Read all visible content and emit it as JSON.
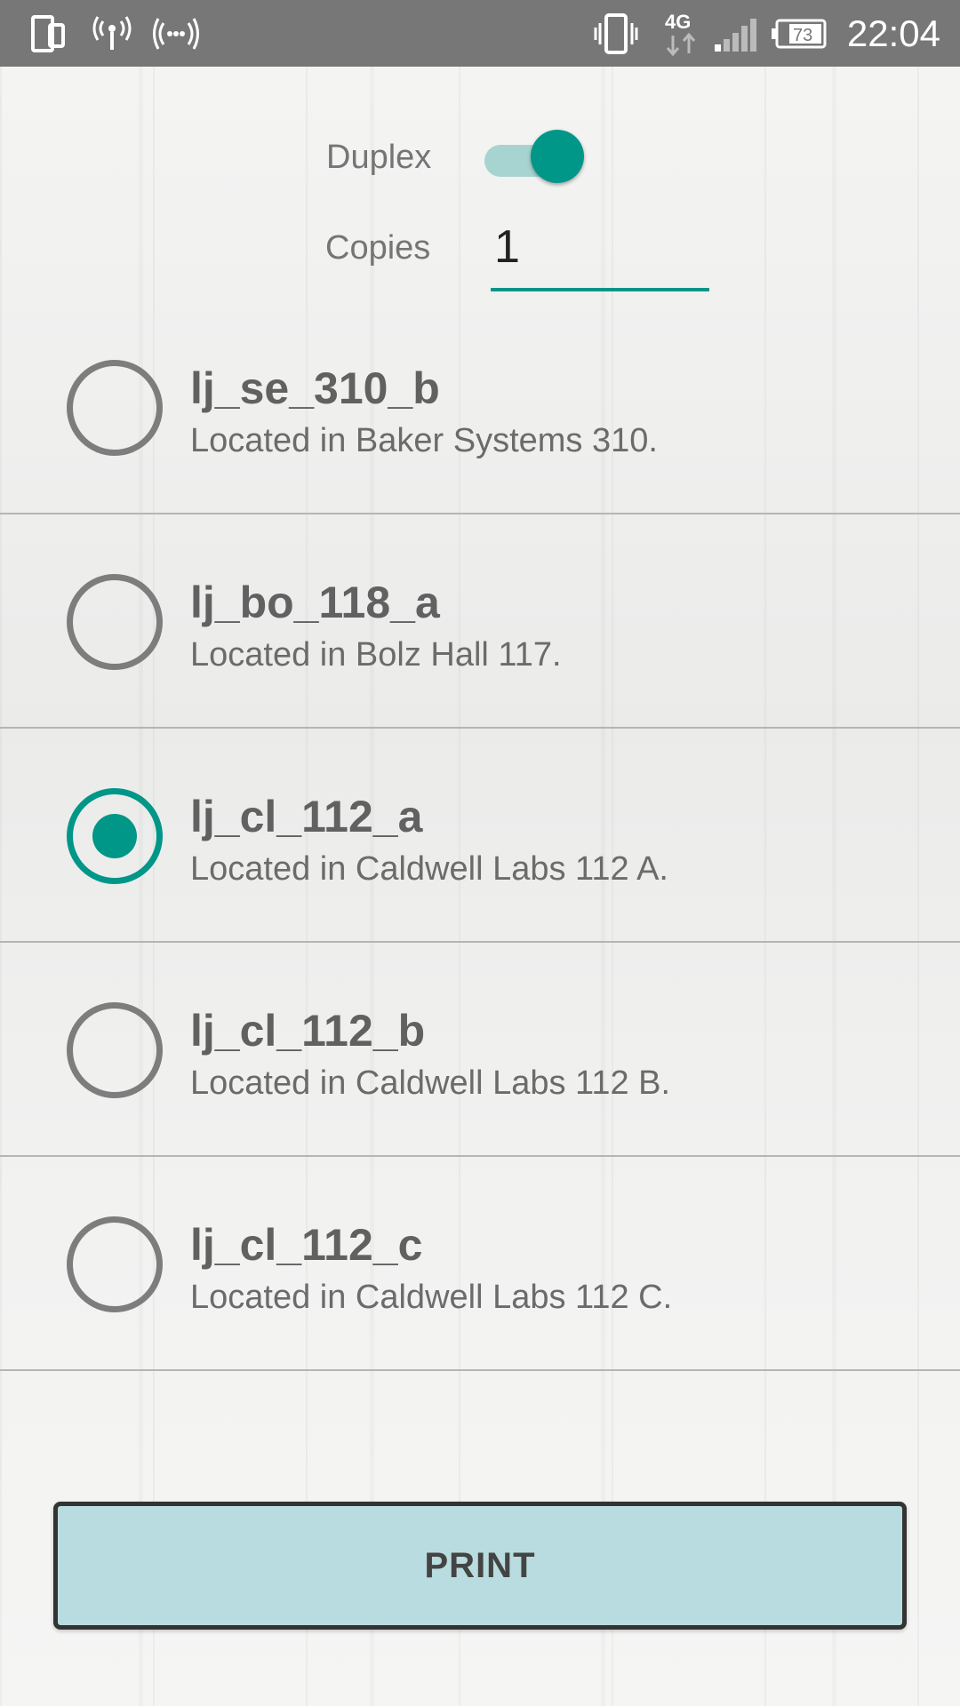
{
  "status_bar": {
    "time": "22:04",
    "battery_level": "73",
    "network_type": "4G",
    "icons": [
      "screen-mirror-icon",
      "hotspot-icon",
      "nfc-icon",
      "vibrate-icon",
      "4g-data-icon",
      "signal-icon",
      "battery-icon"
    ]
  },
  "options": {
    "duplex_label": "Duplex",
    "duplex_on": true,
    "copies_label": "Copies",
    "copies_value": "1"
  },
  "printers": [
    {
      "name": "lj_se_310_b",
      "location": "Located in Baker Systems 310.",
      "selected": false
    },
    {
      "name": "lj_bo_118_a",
      "location": "Located in Bolz Hall 117.",
      "selected": false
    },
    {
      "name": "lj_cl_112_a",
      "location": "Located in Caldwell Labs 112 A.",
      "selected": true
    },
    {
      "name": "lj_cl_112_b",
      "location": "Located in Caldwell Labs 112 B.",
      "selected": false
    },
    {
      "name": "lj_cl_112_c",
      "location": "Located in Caldwell Labs 112 C.",
      "selected": false
    }
  ],
  "print_button_label": "PRINT",
  "colors": {
    "accent": "#009688",
    "toggle_track": "#a7d4d0",
    "button_bg": "#b8dcdf",
    "status_bar": "#777777"
  }
}
